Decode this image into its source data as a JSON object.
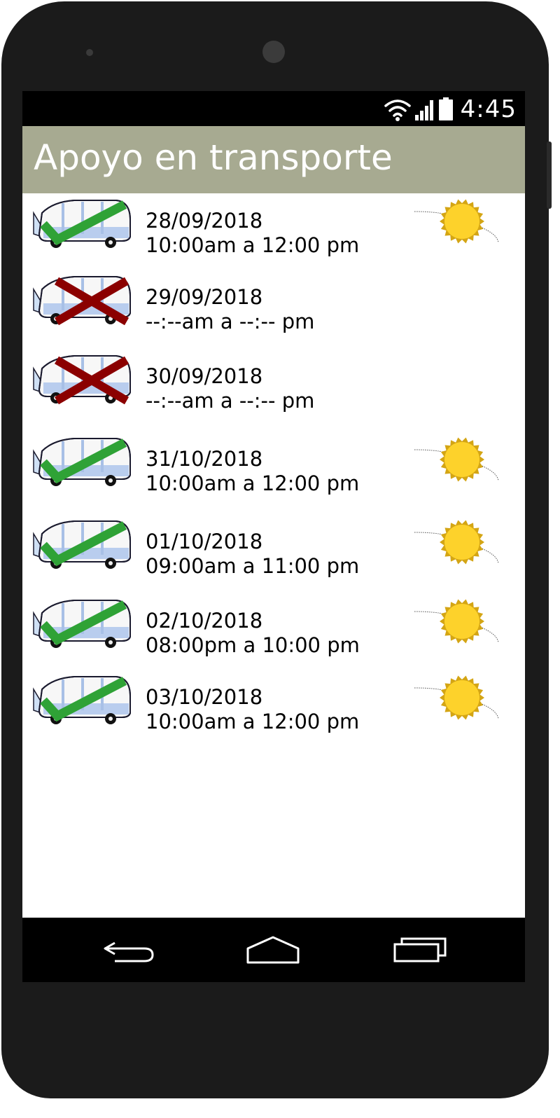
{
  "status_bar": {
    "time": "4:45"
  },
  "app_bar": {
    "title": "Apoyo en transporte"
  },
  "items": [
    {
      "date": "28/09/2018",
      "time_range": "10:00am a 12:00 pm",
      "status": "confirmed",
      "weather": "sunny"
    },
    {
      "date": "29/09/2018",
      "time_range": "--:--am a --:-- pm",
      "status": "cancelled",
      "weather": "none"
    },
    {
      "date": "30/09/2018",
      "time_range": "--:--am a --:-- pm",
      "status": "cancelled",
      "weather": "none"
    },
    {
      "date": "31/10/2018",
      "time_range": "10:00am a 12:00 pm",
      "status": "confirmed",
      "weather": "sunny"
    },
    {
      "date": "01/10/2018",
      "time_range": "09:00am a 11:00 pm",
      "status": "confirmed",
      "weather": "sunny"
    },
    {
      "date": "02/10/2018",
      "time_range": "08:00pm a 10:00 pm",
      "status": "confirmed",
      "weather": "sunny"
    },
    {
      "date": "03/10/2018",
      "time_range": "10:00am a 12:00 pm",
      "status": "confirmed",
      "weather": "sunny"
    }
  ],
  "colors": {
    "app_bar": "#a7aa91",
    "check": "#2fa236",
    "cross": "#8b0000",
    "sun": "#fdd22b",
    "sun_rays": "#d4a514"
  },
  "icons": {
    "status": [
      "wifi-icon",
      "signal-icon",
      "battery-icon"
    ],
    "nav": [
      "back-icon",
      "home-icon",
      "recents-icon"
    ],
    "row": [
      "bus-icon",
      "check-icon",
      "cross-icon",
      "sun-icon"
    ]
  }
}
